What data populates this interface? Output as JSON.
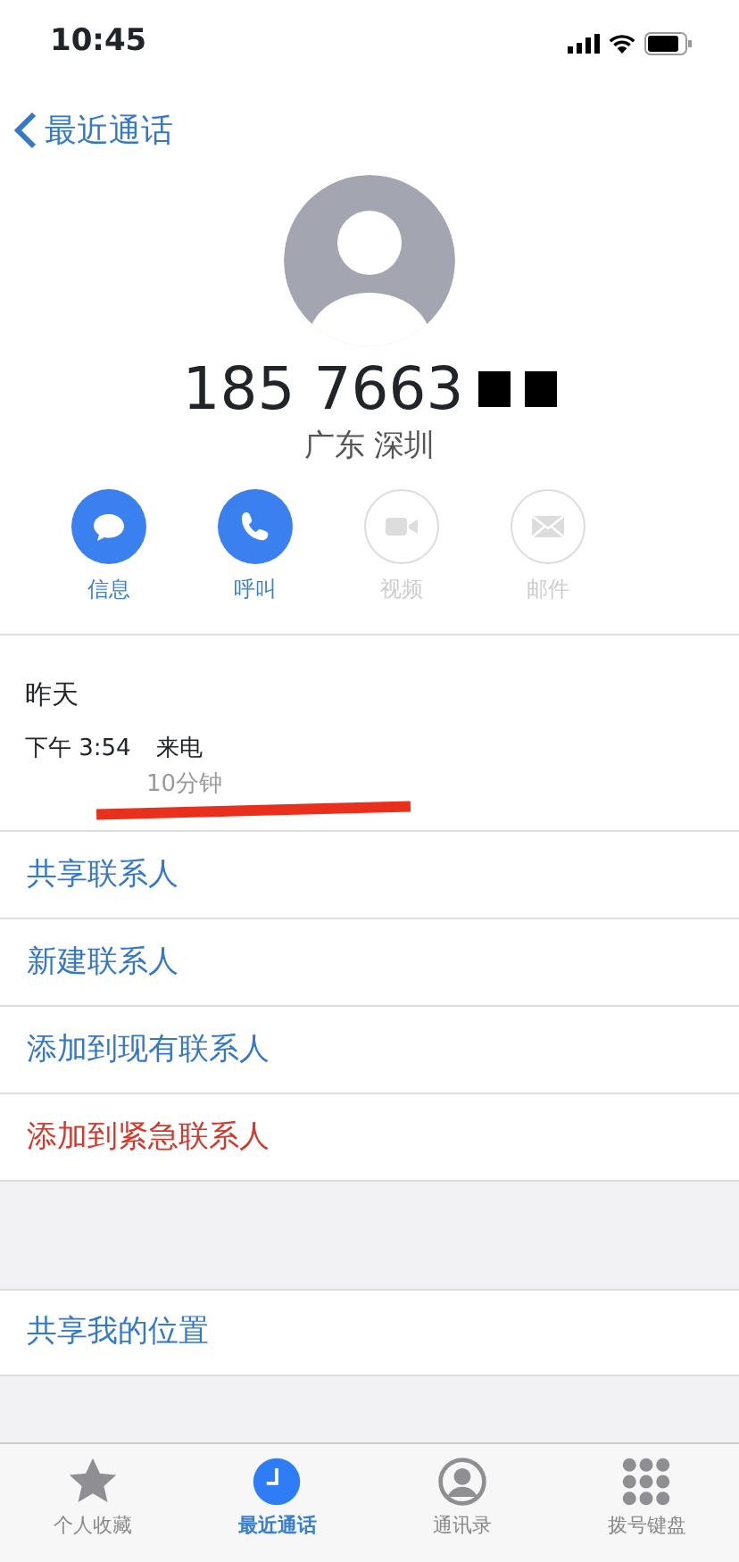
{
  "status_bar": {
    "time": "10:45"
  },
  "nav": {
    "back_label": "最近通话"
  },
  "contact": {
    "number": "185 7663",
    "location": "广东 深圳"
  },
  "actions": [
    {
      "kind": "message",
      "label": "信息",
      "disabled": false
    },
    {
      "kind": "call",
      "label": "呼叫",
      "disabled": false
    },
    {
      "kind": "video",
      "label": "视频",
      "disabled": true
    },
    {
      "kind": "mail",
      "label": "邮件",
      "disabled": true
    }
  ],
  "call_log": {
    "day": "昨天",
    "time": "下午 3:54",
    "type": "来电",
    "duration": "10分钟"
  },
  "options": [
    {
      "label": "共享联系人",
      "kind": "normal"
    },
    {
      "label": "新建联系人",
      "kind": "normal"
    },
    {
      "label": "添加到现有联系人",
      "kind": "normal"
    },
    {
      "label": "添加到紧急联系人",
      "kind": "destructive"
    }
  ],
  "location_option": {
    "label": "共享我的位置"
  },
  "tabs": [
    {
      "kind": "favorites",
      "label": "个人收藏",
      "selected": false
    },
    {
      "kind": "recents",
      "label": "最近通话",
      "selected": true
    },
    {
      "kind": "contacts",
      "label": "通讯录",
      "selected": false
    },
    {
      "kind": "keypad",
      "label": "拨号键盘",
      "selected": false
    }
  ]
}
